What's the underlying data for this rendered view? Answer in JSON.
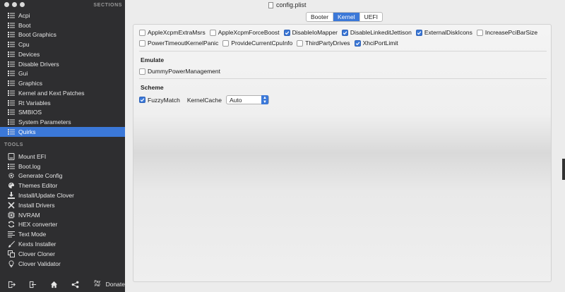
{
  "window": {
    "title": "config.plist"
  },
  "sidebar": {
    "sections_title": "SECTIONS",
    "sections": [
      {
        "label": "Acpi",
        "icon": "list-icon"
      },
      {
        "label": "Boot",
        "icon": "list-icon"
      },
      {
        "label": "Boot Graphics",
        "icon": "list-icon"
      },
      {
        "label": "Cpu",
        "icon": "list-icon"
      },
      {
        "label": "Devices",
        "icon": "list-icon"
      },
      {
        "label": "Disable Drivers",
        "icon": "list-icon"
      },
      {
        "label": "Gui",
        "icon": "list-icon"
      },
      {
        "label": "Graphics",
        "icon": "list-icon"
      },
      {
        "label": "Kernel and Kext Patches",
        "icon": "list-icon"
      },
      {
        "label": "Rt Variables",
        "icon": "list-icon"
      },
      {
        "label": "SMBIOS",
        "icon": "list-icon"
      },
      {
        "label": "System Parameters",
        "icon": "list-icon"
      },
      {
        "label": "Quirks",
        "icon": "list-icon",
        "active": true
      }
    ],
    "tools_title": "TOOLS",
    "tools": [
      {
        "label": "Mount EFI",
        "icon": "drive-icon"
      },
      {
        "label": "Boot.log",
        "icon": "list-icon"
      },
      {
        "label": "Generate Config",
        "icon": "gear-icon"
      },
      {
        "label": "Themes Editor",
        "icon": "palette-icon"
      },
      {
        "label": "Install/Update Clover",
        "icon": "download-icon"
      },
      {
        "label": "Install Drivers",
        "icon": "tools-icon"
      },
      {
        "label": "NVRAM",
        "icon": "chip-icon"
      },
      {
        "label": "HEX converter",
        "icon": "refresh-icon"
      },
      {
        "label": "Text Mode",
        "icon": "text-lines-icon"
      },
      {
        "label": "Kexts Installer",
        "icon": "brush-icon"
      },
      {
        "label": "Clover Cloner",
        "icon": "copy-icon"
      },
      {
        "label": "Clover Validator",
        "icon": "lightbulb-icon"
      }
    ],
    "bottom": {
      "donate_label": "Donate",
      "paypal_mark": "Pay Pal"
    }
  },
  "tabs": [
    {
      "label": "Booter",
      "active": false
    },
    {
      "label": "Kernel",
      "active": true
    },
    {
      "label": "UEFI",
      "active": false
    }
  ],
  "kernel": {
    "quirks_row1": [
      {
        "label": "AppleXcpmExtraMsrs",
        "checked": false
      },
      {
        "label": "AppleXcpmForceBoost",
        "checked": false
      },
      {
        "label": "DisableIoMapper",
        "checked": true
      },
      {
        "label": "DisableLinkeditJettison",
        "checked": true
      },
      {
        "label": "ExternalDiskIcons",
        "checked": true
      },
      {
        "label": "IncreasePciBarSize",
        "checked": false
      }
    ],
    "quirks_row2": [
      {
        "label": "PowerTimeoutKernelPanic",
        "checked": false
      },
      {
        "label": "ProvideCurrentCpuInfo",
        "checked": false
      },
      {
        "label": "ThirdPartyDrives",
        "checked": false
      },
      {
        "label": "XhciPortLimit",
        "checked": true
      }
    ],
    "emulate": {
      "title": "Emulate",
      "items": [
        {
          "label": "DummyPowerManagement",
          "checked": false
        }
      ]
    },
    "scheme": {
      "title": "Scheme",
      "fuzzy_match": {
        "label": "FuzzyMatch",
        "checked": true
      },
      "kernel_cache_label": "KernelCache",
      "kernel_cache_value": "Auto"
    }
  },
  "colors": {
    "accent": "#3b78d8",
    "sidebar_bg": "#2e2e30"
  }
}
